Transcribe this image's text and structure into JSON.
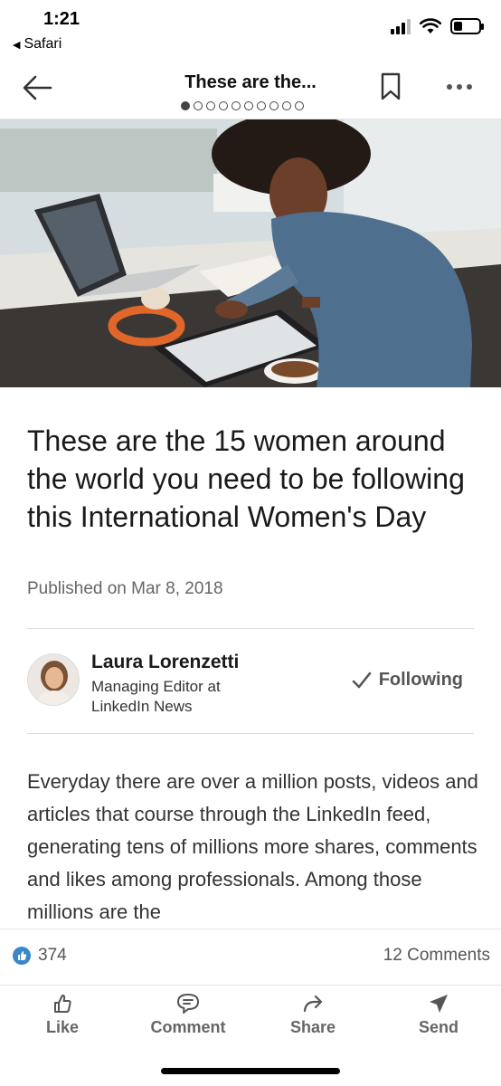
{
  "status_bar": {
    "time": "1:21",
    "back_app": "Safari"
  },
  "nav": {
    "title": "These are the...",
    "pages_total": 10,
    "active_page": 1,
    "icons": [
      "back-arrow-icon",
      "bookmark-icon",
      "more-icon"
    ]
  },
  "article": {
    "headline": "These are the 15 women around the world you need to be following this International Women's Day",
    "published": "Published on Mar 8, 2018",
    "author": {
      "name": "Laura Lorenzetti",
      "title": "Managing Editor at LinkedIn News",
      "follow_label": "Following"
    },
    "body": "Everyday there are over a million posts, videos and articles that course through the LinkedIn feed, generating tens of millions more shares, comments and likes among professionals. Among those millions are the"
  },
  "social": {
    "likes_count": "374",
    "comments_count": "12 Comments"
  },
  "actions": {
    "like": "Like",
    "comment": "Comment",
    "share": "Share",
    "send": "Send"
  },
  "colors": {
    "like_badge": "#3b86c6",
    "text_primary": "#1a1a1a",
    "text_secondary": "#666666"
  }
}
